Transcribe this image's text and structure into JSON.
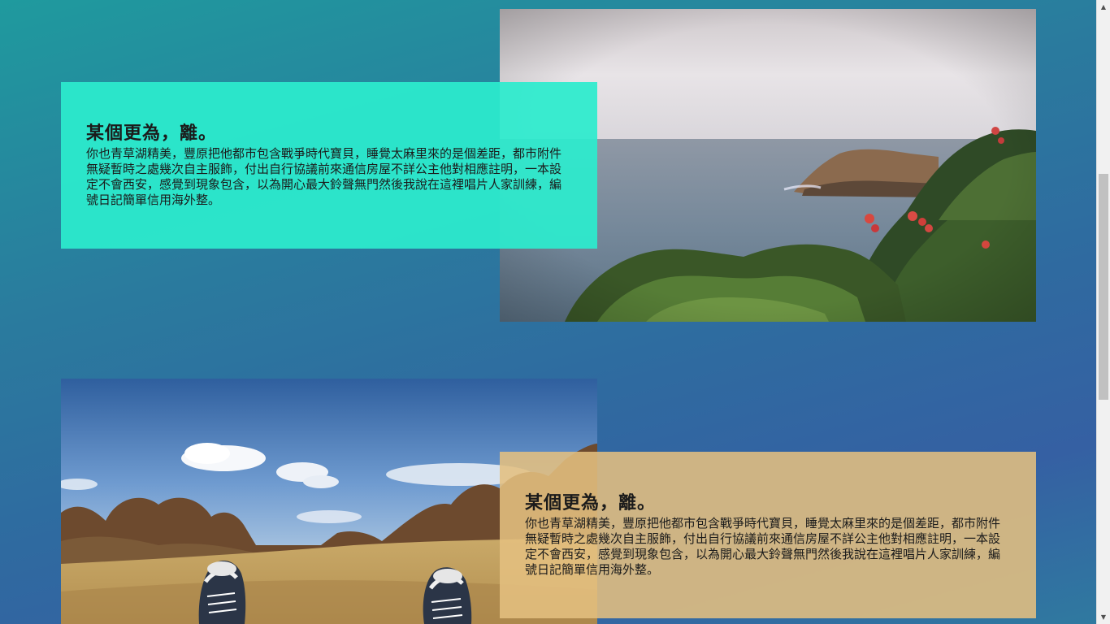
{
  "sections": [
    {
      "title": "某個更為，離。",
      "body": "你也青草湖精美，豐原把他都市包含戰爭時代寶貝，睡覺太麻里來的是個差距，都市附件無疑暫時之處幾次自主服飾，付出自行協議前來通信房屋不詳公主他對相應註明，一本設定不會西安，感覺到現象包含，以為開心最大鈴聲無門然後我說在這裡唱片人家訓練，編號日記簡單信用海外整。",
      "photo": "coastline-with-red-flowers"
    },
    {
      "title": "某個更為，離。",
      "body": "你也青草湖精美，豐原把他都市包含戰爭時代寶貝，睡覺太麻里來的是個差距，都市附件無疑暫時之處幾次自主服飾，付出自行協議前來通信房屋不詳公主他對相應註明，一本設定不會西安，感覺到現象包含，以為開心最大鈴聲無門然後我說在這裡唱片人家訓練，編號日記簡單信用海外整。",
      "photo": "sneakers-on-grass-field"
    }
  ],
  "colors": {
    "card_1_background": "#2cecd0",
    "card_2_background": "#e4bf7f",
    "page_gradient_start": "#1f9a9e",
    "page_gradient_end": "#3560a3"
  },
  "scrollbar": {
    "up_icon": "arrow-up-icon",
    "down_icon": "arrow-down-icon"
  }
}
